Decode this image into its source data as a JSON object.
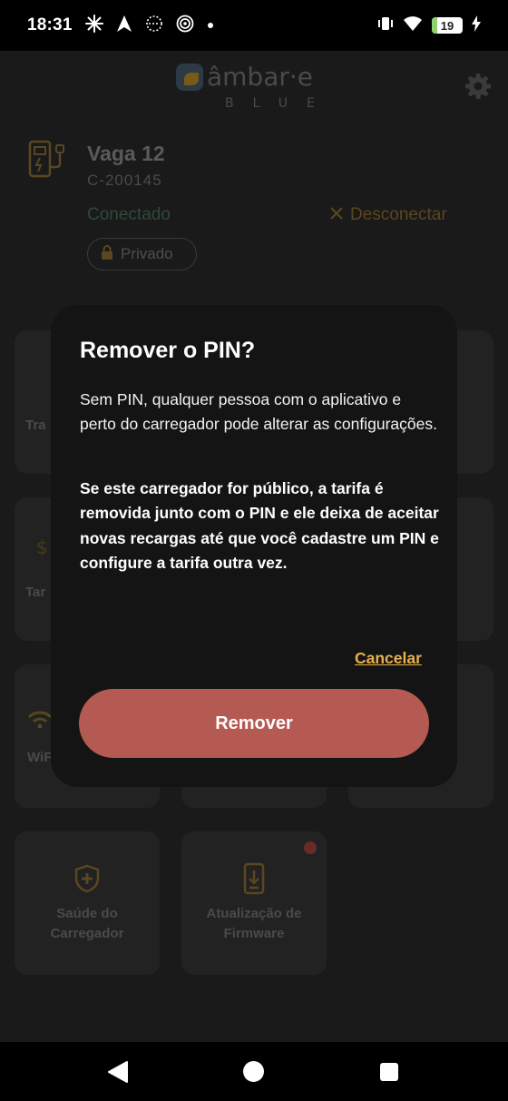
{
  "status_bar": {
    "time": "18:31",
    "battery_level": "19",
    "battery_fraction": 0.19,
    "icons": [
      "pinwheel-icon",
      "navigation-icon",
      "hotspot-icon",
      "target-icon",
      "dot-icon",
      "vibrate-icon",
      "wifi-icon",
      "battery-icon",
      "charging-icon"
    ]
  },
  "header": {
    "logo_text": "âmbar·e",
    "logo_sub": "BLUE",
    "settings_icon": "gear-icon"
  },
  "charger": {
    "title": "Vaga 12",
    "code": "C-200145",
    "status": "Conectado",
    "disconnect_label": "Desconectar",
    "privacy_label": "Privado"
  },
  "tiles": [
    {
      "label": "Tra",
      "icon": "transfer-icon"
    },
    {
      "label": "Tar",
      "icon": "tariff-icon"
    },
    {
      "label": "WiF",
      "icon": "wifi-icon"
    },
    {
      "label": "Saúde do Carregador",
      "icon": "shield-plus-icon"
    },
    {
      "label": "Atualização de Firmware",
      "icon": "firmware-update-icon",
      "badge": true
    }
  ],
  "dialog": {
    "title": "Remover o PIN?",
    "body": "Sem PIN, qualquer pessoa com o aplicativo e perto do carregador pode alterar as configurações.",
    "warning": "Se este carregador for público, a tarifa é removida junto com o PIN e ele deixa de aceitar novas recargas até que você cadastre um PIN e configure a tarifa outra vez.",
    "cancel_label": "Cancelar",
    "remove_label": "Remover"
  },
  "colors": {
    "accent": "#e8b04c",
    "danger": "#b55a52",
    "dialog_bg": "#141414"
  }
}
